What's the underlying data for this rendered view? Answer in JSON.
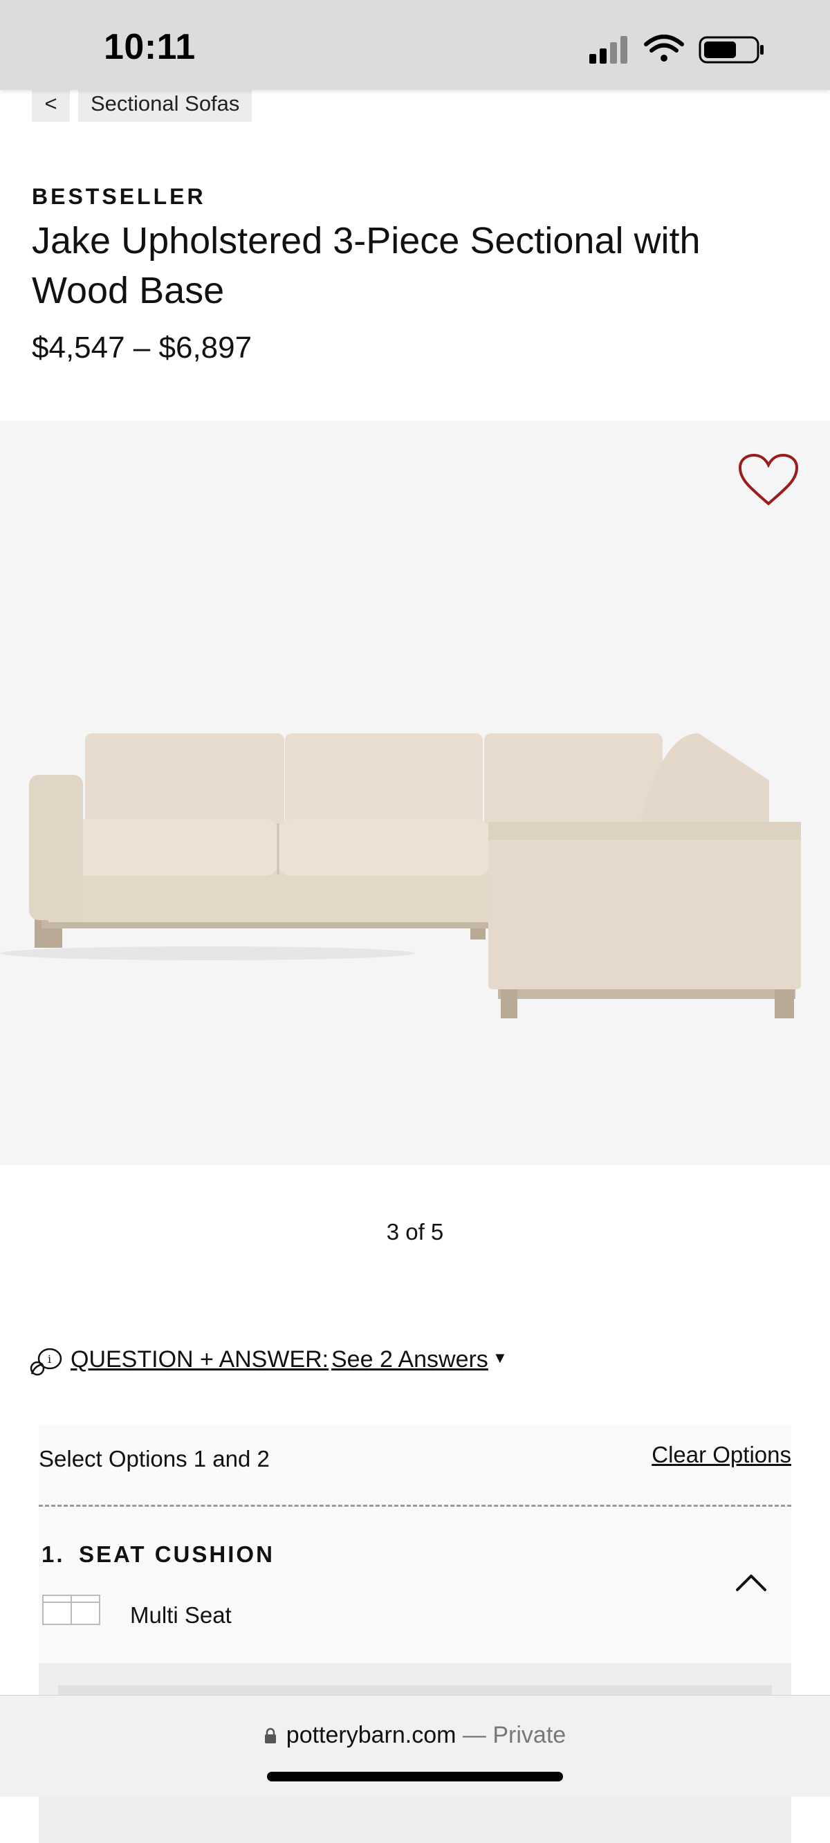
{
  "status_bar": {
    "time": "10:11",
    "icons": [
      "cellular-signal-icon",
      "wifi-icon",
      "battery-icon"
    ]
  },
  "breadcrumb": {
    "back": "<",
    "label": "Sectional Sofas"
  },
  "product": {
    "badge": "BESTSELLER",
    "title": "Jake Upholstered 3-Piece Sectional with Wood Base",
    "price": "$4,547 – $6,897"
  },
  "gallery": {
    "counter": "3 of 5",
    "favorite_icon": "heart-outline-icon"
  },
  "qa": {
    "label": "QUESTION + ANSWER:",
    "link": "See 2 Answers",
    "caret": "▼"
  },
  "options": {
    "instructions": "Select Options 1 and 2",
    "clear": "Clear Options",
    "step_number": "1.",
    "step_title": "SEAT CUSHION",
    "seat_value": "Multi Seat"
  },
  "browser": {
    "domain": "potterybarn.com",
    "separator": "—",
    "mode": "Private"
  },
  "colors": {
    "status_bg": "#dcdcdc",
    "image_bg": "#f5f5f5",
    "sofa_fabric": "#e8ddd0",
    "wood_base": "#b8aa95",
    "heart": "#9b1c1c"
  }
}
